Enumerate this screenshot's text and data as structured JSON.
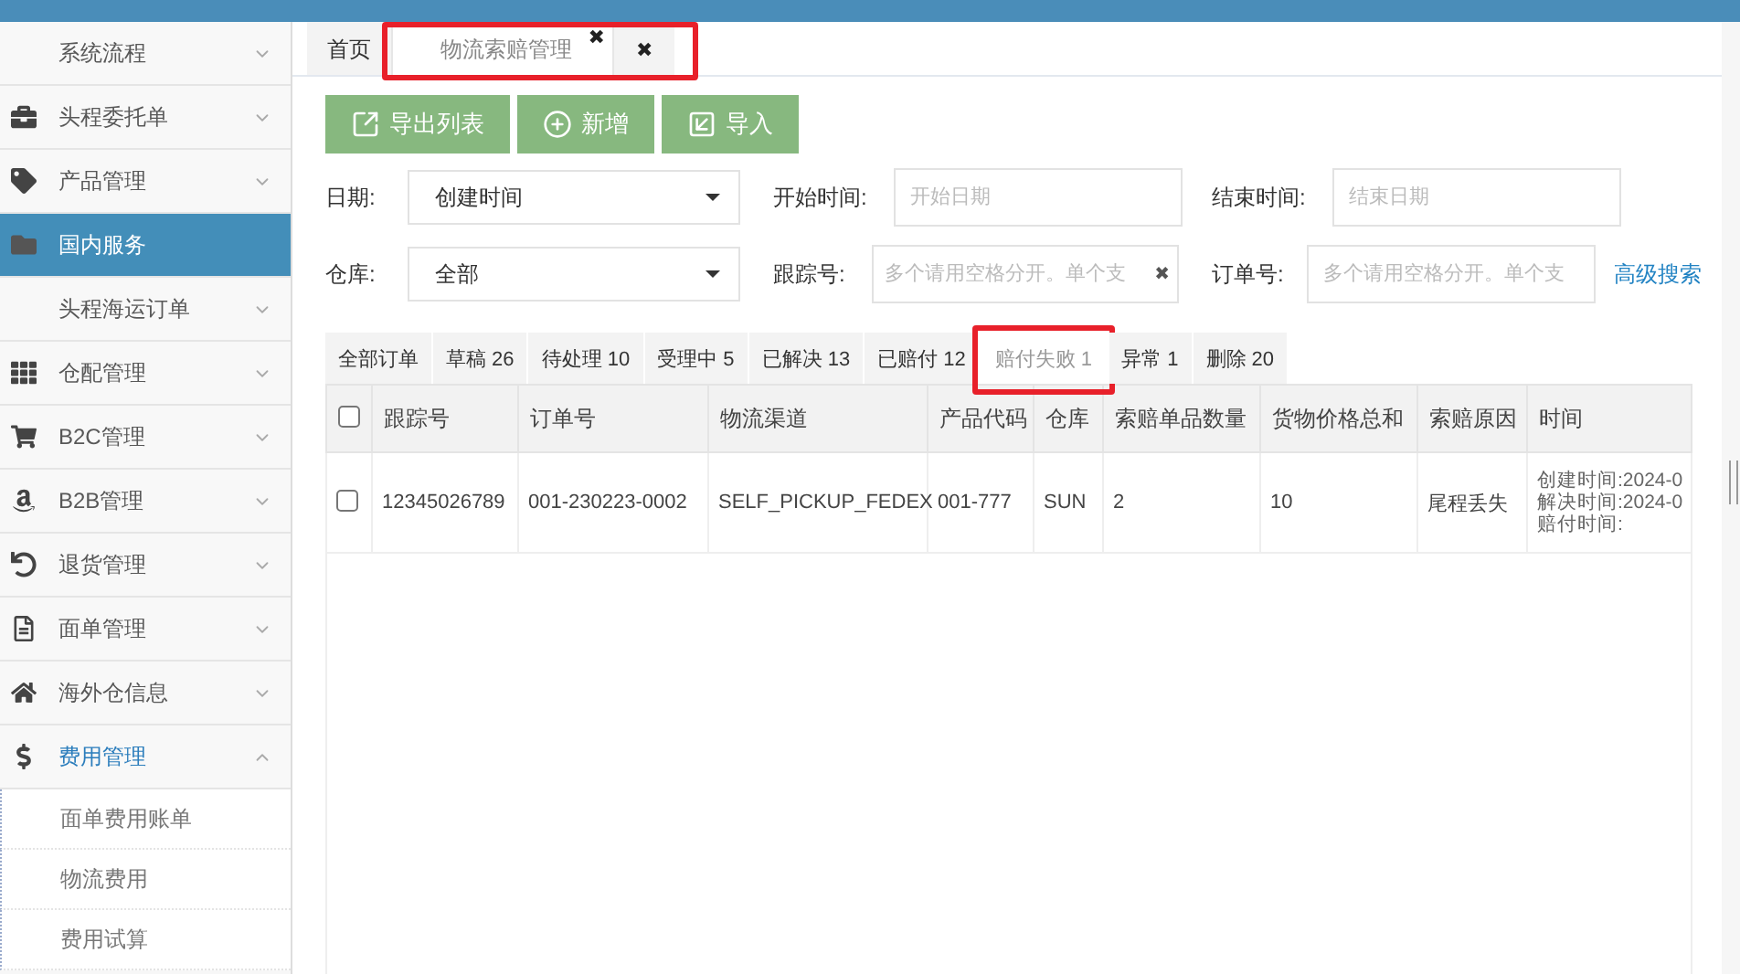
{
  "sidebar": {
    "items": [
      {
        "label": "系统流程",
        "selected": false,
        "expanded": false
      },
      {
        "label": "头程委托单",
        "selected": false,
        "expanded": false
      },
      {
        "label": "产品管理",
        "selected": false,
        "expanded": false
      },
      {
        "label": "国内服务",
        "selected": true,
        "expanded": false
      },
      {
        "label": "头程海运订单",
        "selected": false,
        "expanded": false
      },
      {
        "label": "仓配管理",
        "selected": false,
        "expanded": false
      },
      {
        "label": "B2C管理",
        "selected": false,
        "expanded": false
      },
      {
        "label": "B2B管理",
        "selected": false,
        "expanded": false
      },
      {
        "label": "退货管理",
        "selected": false,
        "expanded": false
      },
      {
        "label": "面单管理",
        "selected": false,
        "expanded": false
      },
      {
        "label": "海外仓信息",
        "selected": false,
        "expanded": false
      },
      {
        "label": "费用管理",
        "selected": false,
        "expanded": true,
        "children": [
          {
            "label": "面单费用账单"
          },
          {
            "label": "物流费用"
          },
          {
            "label": "费用试算"
          }
        ]
      }
    ]
  },
  "page_tabs": [
    {
      "label": "首页",
      "selected": false,
      "highlighted": false
    },
    {
      "label": "物流索赔管理",
      "selected": true,
      "close_icon": "✖",
      "highlighted": true
    }
  ],
  "close_all": "✖",
  "toolbar": {
    "buttons": [
      {
        "label": "导出列表",
        "kind": "export"
      },
      {
        "label": "新增",
        "kind": "add"
      },
      {
        "label": "导入",
        "kind": "import"
      }
    ]
  },
  "filters": {
    "date_label": "日期:",
    "date_value": "创建时间",
    "start_label": "开始时间:",
    "start_placeholder": "开始日期",
    "end_label": "结束时间:",
    "end_placeholder": "结束日期",
    "warehouse_label": "仓库:",
    "warehouse_value": "全部",
    "tracking_label": "跟踪号:",
    "tracking_placeholder": "多个请用空格分开。单个支",
    "tracking_clear": "✖",
    "order_label": "订单号:",
    "order_placeholder": "多个请用空格分开。单个支",
    "advanced_link": "高级搜索"
  },
  "status_tabs": [
    {
      "label": "全部订单",
      "selected": false,
      "highlighted": false
    },
    {
      "label": "草稿 26",
      "selected": false,
      "highlighted": false
    },
    {
      "label": "待处理 10",
      "selected": false,
      "highlighted": false
    },
    {
      "label": "受理中 5",
      "selected": false,
      "highlighted": false
    },
    {
      "label": "已解决 13",
      "selected": false,
      "highlighted": false
    },
    {
      "label": "已赔付 12",
      "selected": false,
      "highlighted": false
    },
    {
      "label": "赔付失败 1",
      "selected": true,
      "highlighted": true
    },
    {
      "label": "异常 1",
      "selected": false,
      "highlighted": false
    },
    {
      "label": "删除 20",
      "selected": false,
      "highlighted": false
    }
  ],
  "table": {
    "columns": [
      "跟踪号",
      "订单号",
      "物流渠道",
      "产品代码",
      "仓库",
      "索赔单品数量",
      "货物价格总和",
      "索赔原因",
      "时间"
    ],
    "all_checked": false,
    "rows": [
      {
        "checked": false,
        "cells": [
          "12345026789",
          "001-230223-0002",
          "SELF_PICKUP_FEDEX",
          "001-777",
          "SUN",
          "2",
          "10",
          "尾程丢失"
        ],
        "times": [
          "创建时间:2024-0",
          "解决时间:2024-0",
          "赔付时间:"
        ]
      }
    ]
  }
}
